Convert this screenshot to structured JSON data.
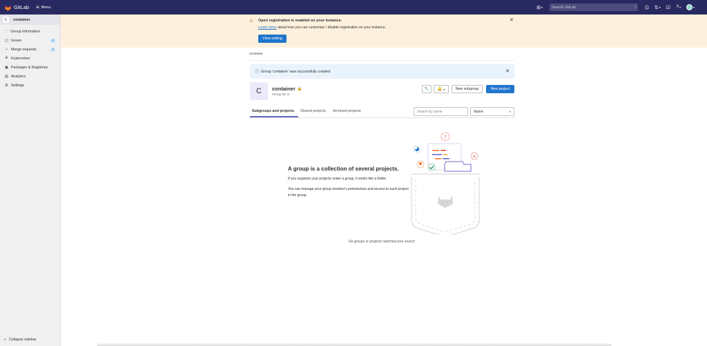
{
  "topbar": {
    "app_name": "GitLab",
    "menu_label": "Menu",
    "search_placeholder": "Search GitLab",
    "search_shortcut": "/"
  },
  "sidebar": {
    "context": {
      "avatar_letter": "C",
      "name": "container"
    },
    "items": [
      {
        "label": "Group information",
        "icon": "group-icon"
      },
      {
        "label": "Issues",
        "icon": "issues-icon",
        "count": "0"
      },
      {
        "label": "Merge requests",
        "icon": "merge-request-icon",
        "count": "0"
      },
      {
        "label": "Kubernetes",
        "icon": "kubernetes-icon"
      },
      {
        "label": "Packages & Registries",
        "icon": "package-icon"
      },
      {
        "label": "Analytics",
        "icon": "analytics-icon"
      },
      {
        "label": "Settings",
        "icon": "settings-icon"
      }
    ],
    "collapse_label": "Collapse sidebar"
  },
  "banner": {
    "title": "Open registration is enabled on your instance.",
    "link_text": "Learn more",
    "body_rest": " about how you can customize / disable registration on your instance.",
    "button_label": "View setting"
  },
  "breadcrumb": "container",
  "alert": {
    "text": "Group 'container' was successfully created."
  },
  "group": {
    "avatar_letter": "C",
    "name": "container",
    "id_text": "Group ID: 8",
    "new_subgroup_label": "New subgroup",
    "new_project_label": "New project"
  },
  "tabs": [
    "Subgroups and projects",
    "Shared projects",
    "Archived projects"
  ],
  "filter": {
    "search_placeholder": "Search by name",
    "sort_value": "Name"
  },
  "empty_state": {
    "title": "A group is a collection of several projects.",
    "p1": "If you organize your projects under a group, it works like a folder.",
    "p2": "You can manage your group member's permissions and access to each project in the group."
  },
  "no_match": "No groups or projects matched your search",
  "colors": {
    "topbar": "#292961",
    "primary": "#1f75cb",
    "banner": "#fdf1dd",
    "tab_active": "#6666c4"
  }
}
